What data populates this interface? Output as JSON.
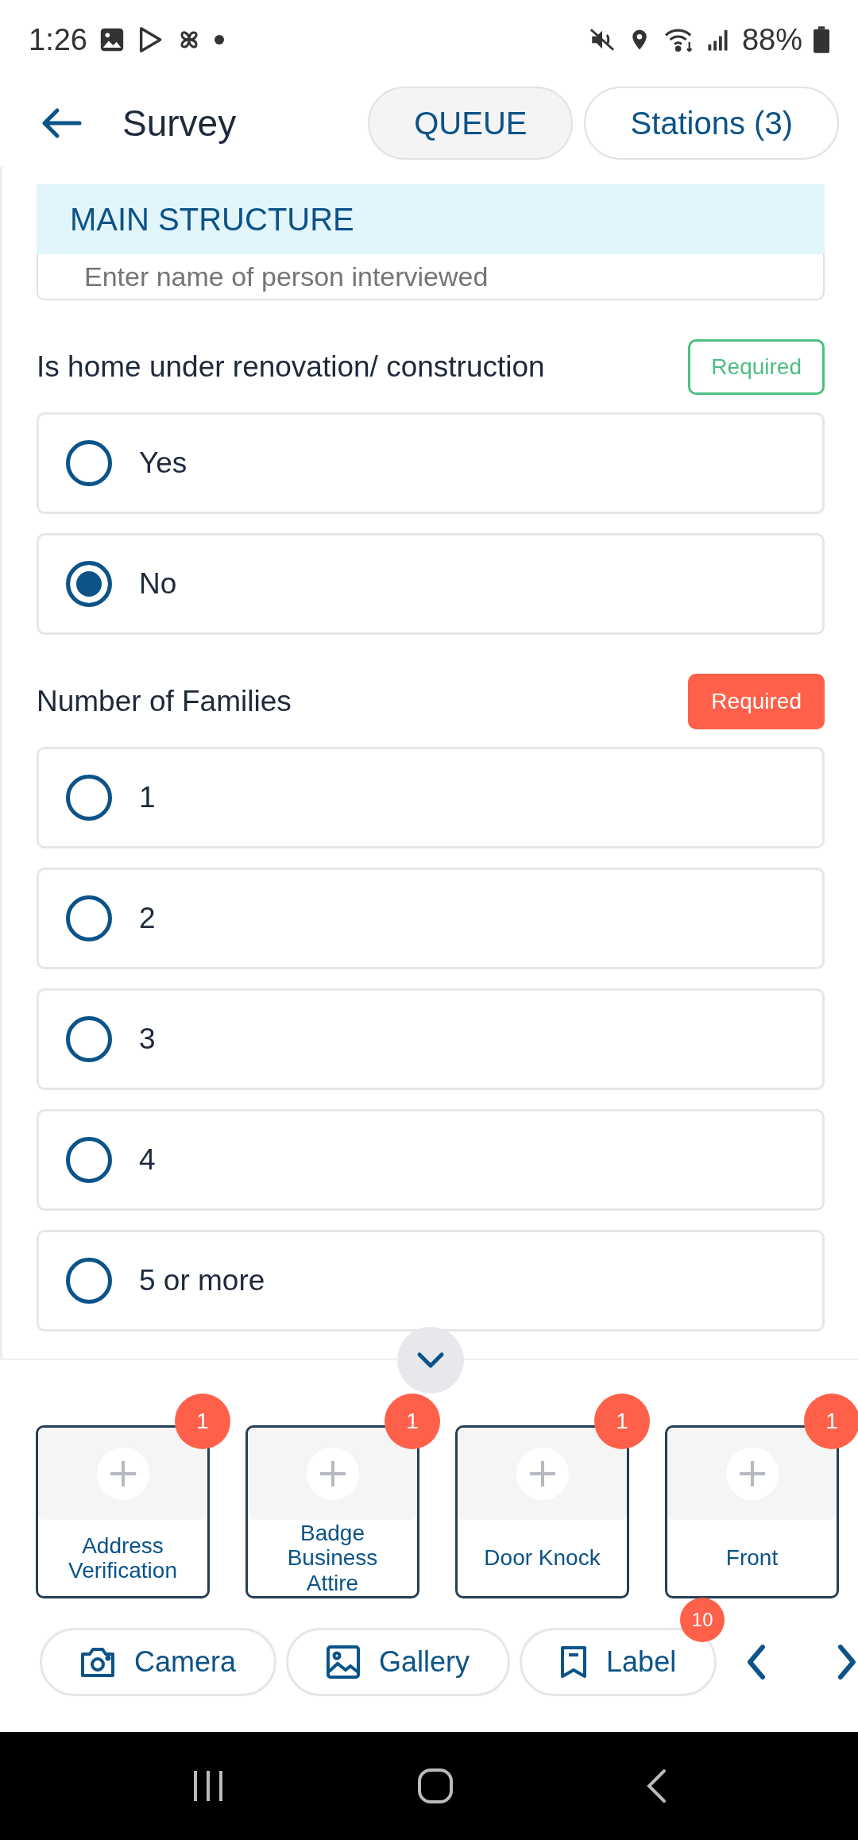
{
  "status_bar": {
    "time": "1:26",
    "battery": "88%"
  },
  "header": {
    "title": "Survey",
    "buttons": [
      {
        "label": "QUEUE",
        "kind": "filled"
      },
      {
        "label": "Stations (3)",
        "kind": "outline"
      }
    ]
  },
  "section": {
    "title": "MAIN STRUCTURE"
  },
  "name_field": {
    "placeholder": "Enter name of person interviewed"
  },
  "questions": [
    {
      "label": "Is home under renovation/ construction",
      "required": "Required",
      "satisfied": true,
      "options": [
        {
          "label": "Yes",
          "selected": false
        },
        {
          "label": "No",
          "selected": true
        }
      ]
    },
    {
      "label": "Number of Families",
      "required": "Required",
      "satisfied": false,
      "options": [
        {
          "label": "1",
          "selected": false
        },
        {
          "label": "2",
          "selected": false
        },
        {
          "label": "3",
          "selected": false
        },
        {
          "label": "4",
          "selected": false
        },
        {
          "label": "5 or more",
          "selected": false
        }
      ]
    }
  ],
  "photo_cards": [
    {
      "label": "Address Verification",
      "count": "1"
    },
    {
      "label": "Badge Business Attire",
      "count": "1"
    },
    {
      "label": "Door Knock",
      "count": "1"
    },
    {
      "label": "Front",
      "count": "1"
    }
  ],
  "actions": [
    {
      "label": "Camera",
      "kind": "camera"
    },
    {
      "label": "Gallery",
      "kind": "gallery"
    },
    {
      "label": "Label",
      "kind": "label",
      "badge": "10"
    }
  ]
}
